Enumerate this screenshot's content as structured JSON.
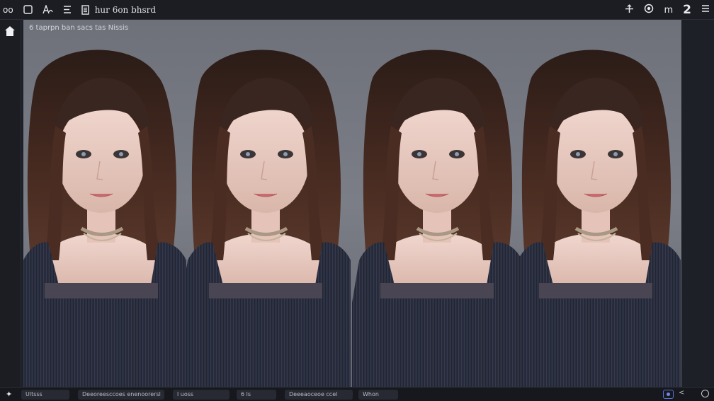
{
  "topbar": {
    "app_label": "oo",
    "title": "hur 6on bhsrd",
    "right_label": "m",
    "right_bold": "2"
  },
  "canvas": {
    "caption": "6  taprpn ban sacs tas Nissis",
    "background": "#73767f",
    "figure_count": 4
  },
  "bottombar": {
    "items": [
      "Ultsss",
      "Deeoreesccoes enenoorersl",
      "l uoss",
      "6 ls",
      "Deeeaoceoe ccel",
      "Whon"
    ]
  },
  "colors": {
    "app_bg": "#1e2027",
    "accent": "#6f87ea",
    "sweater": "#2d3140",
    "hair": "#3a2620"
  }
}
